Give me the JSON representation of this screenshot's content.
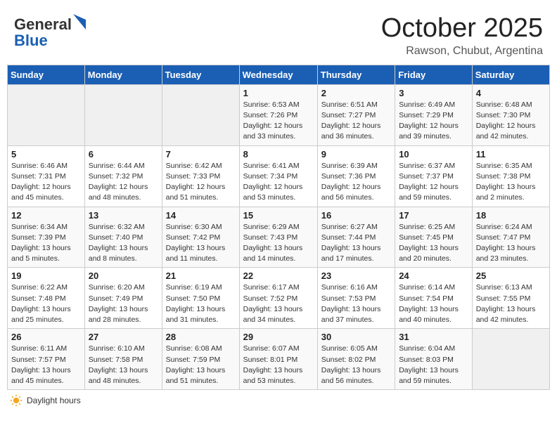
{
  "header": {
    "logo_general": "General",
    "logo_blue": "Blue",
    "month": "October 2025",
    "location": "Rawson, Chubut, Argentina"
  },
  "days_of_week": [
    "Sunday",
    "Monday",
    "Tuesday",
    "Wednesday",
    "Thursday",
    "Friday",
    "Saturday"
  ],
  "weeks": [
    [
      {
        "day": "",
        "info": ""
      },
      {
        "day": "",
        "info": ""
      },
      {
        "day": "",
        "info": ""
      },
      {
        "day": "1",
        "info": "Sunrise: 6:53 AM\nSunset: 7:26 PM\nDaylight: 12 hours\nand 33 minutes."
      },
      {
        "day": "2",
        "info": "Sunrise: 6:51 AM\nSunset: 7:27 PM\nDaylight: 12 hours\nand 36 minutes."
      },
      {
        "day": "3",
        "info": "Sunrise: 6:49 AM\nSunset: 7:29 PM\nDaylight: 12 hours\nand 39 minutes."
      },
      {
        "day": "4",
        "info": "Sunrise: 6:48 AM\nSunset: 7:30 PM\nDaylight: 12 hours\nand 42 minutes."
      }
    ],
    [
      {
        "day": "5",
        "info": "Sunrise: 6:46 AM\nSunset: 7:31 PM\nDaylight: 12 hours\nand 45 minutes."
      },
      {
        "day": "6",
        "info": "Sunrise: 6:44 AM\nSunset: 7:32 PM\nDaylight: 12 hours\nand 48 minutes."
      },
      {
        "day": "7",
        "info": "Sunrise: 6:42 AM\nSunset: 7:33 PM\nDaylight: 12 hours\nand 51 minutes."
      },
      {
        "day": "8",
        "info": "Sunrise: 6:41 AM\nSunset: 7:34 PM\nDaylight: 12 hours\nand 53 minutes."
      },
      {
        "day": "9",
        "info": "Sunrise: 6:39 AM\nSunset: 7:36 PM\nDaylight: 12 hours\nand 56 minutes."
      },
      {
        "day": "10",
        "info": "Sunrise: 6:37 AM\nSunset: 7:37 PM\nDaylight: 12 hours\nand 59 minutes."
      },
      {
        "day": "11",
        "info": "Sunrise: 6:35 AM\nSunset: 7:38 PM\nDaylight: 13 hours\nand 2 minutes."
      }
    ],
    [
      {
        "day": "12",
        "info": "Sunrise: 6:34 AM\nSunset: 7:39 PM\nDaylight: 13 hours\nand 5 minutes."
      },
      {
        "day": "13",
        "info": "Sunrise: 6:32 AM\nSunset: 7:40 PM\nDaylight: 13 hours\nand 8 minutes."
      },
      {
        "day": "14",
        "info": "Sunrise: 6:30 AM\nSunset: 7:42 PM\nDaylight: 13 hours\nand 11 minutes."
      },
      {
        "day": "15",
        "info": "Sunrise: 6:29 AM\nSunset: 7:43 PM\nDaylight: 13 hours\nand 14 minutes."
      },
      {
        "day": "16",
        "info": "Sunrise: 6:27 AM\nSunset: 7:44 PM\nDaylight: 13 hours\nand 17 minutes."
      },
      {
        "day": "17",
        "info": "Sunrise: 6:25 AM\nSunset: 7:45 PM\nDaylight: 13 hours\nand 20 minutes."
      },
      {
        "day": "18",
        "info": "Sunrise: 6:24 AM\nSunset: 7:47 PM\nDaylight: 13 hours\nand 23 minutes."
      }
    ],
    [
      {
        "day": "19",
        "info": "Sunrise: 6:22 AM\nSunset: 7:48 PM\nDaylight: 13 hours\nand 25 minutes."
      },
      {
        "day": "20",
        "info": "Sunrise: 6:20 AM\nSunset: 7:49 PM\nDaylight: 13 hours\nand 28 minutes."
      },
      {
        "day": "21",
        "info": "Sunrise: 6:19 AM\nSunset: 7:50 PM\nDaylight: 13 hours\nand 31 minutes."
      },
      {
        "day": "22",
        "info": "Sunrise: 6:17 AM\nSunset: 7:52 PM\nDaylight: 13 hours\nand 34 minutes."
      },
      {
        "day": "23",
        "info": "Sunrise: 6:16 AM\nSunset: 7:53 PM\nDaylight: 13 hours\nand 37 minutes."
      },
      {
        "day": "24",
        "info": "Sunrise: 6:14 AM\nSunset: 7:54 PM\nDaylight: 13 hours\nand 40 minutes."
      },
      {
        "day": "25",
        "info": "Sunrise: 6:13 AM\nSunset: 7:55 PM\nDaylight: 13 hours\nand 42 minutes."
      }
    ],
    [
      {
        "day": "26",
        "info": "Sunrise: 6:11 AM\nSunset: 7:57 PM\nDaylight: 13 hours\nand 45 minutes."
      },
      {
        "day": "27",
        "info": "Sunrise: 6:10 AM\nSunset: 7:58 PM\nDaylight: 13 hours\nand 48 minutes."
      },
      {
        "day": "28",
        "info": "Sunrise: 6:08 AM\nSunset: 7:59 PM\nDaylight: 13 hours\nand 51 minutes."
      },
      {
        "day": "29",
        "info": "Sunrise: 6:07 AM\nSunset: 8:01 PM\nDaylight: 13 hours\nand 53 minutes."
      },
      {
        "day": "30",
        "info": "Sunrise: 6:05 AM\nSunset: 8:02 PM\nDaylight: 13 hours\nand 56 minutes."
      },
      {
        "day": "31",
        "info": "Sunrise: 6:04 AM\nSunset: 8:03 PM\nDaylight: 13 hours\nand 59 minutes."
      },
      {
        "day": "",
        "info": ""
      }
    ]
  ],
  "footer": {
    "daylight_label": "Daylight hours"
  }
}
